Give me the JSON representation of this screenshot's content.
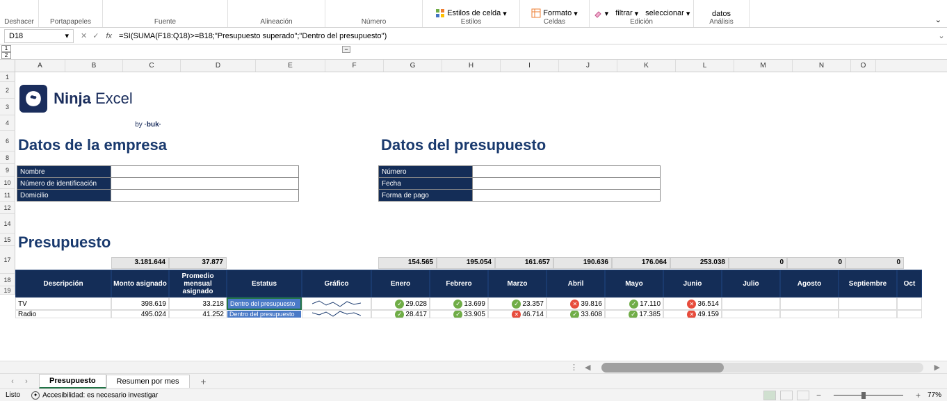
{
  "ribbon": {
    "groups": {
      "undo": "Deshacer",
      "clipboard": "Portapapeles",
      "font": "Fuente",
      "alignment": "Alineación",
      "number": "Número",
      "styles": "Estilos",
      "cells": "Celdas",
      "editing": "Edición",
      "analysis": "Análisis"
    },
    "styles_items": {
      "cell_styles": "Estilos de celda"
    },
    "cells_items": {
      "format": "Formato"
    },
    "editing_items": {
      "filter": "filtrar",
      "select": "seleccionar"
    },
    "analysis_items": {
      "data": "datos"
    }
  },
  "formula_bar": {
    "cell_ref": "D18",
    "formula": "=SI(SUMA(F18:Q18)>=B18;\"Presupuesto superado\";\"Dentro del presupuesto\")"
  },
  "outline": {
    "level1": "1",
    "level2": "2"
  },
  "columns": [
    "A",
    "B",
    "C",
    "D",
    "E",
    "F",
    "G",
    "H",
    "I",
    "J",
    "K",
    "L",
    "M",
    "N",
    "O"
  ],
  "rows": [
    "1",
    "2",
    "3",
    "4",
    "6",
    "8",
    "9",
    "10",
    "11",
    "12",
    "14",
    "15",
    "17",
    "18",
    "19"
  ],
  "logo": {
    "brand_bold": "Ninja",
    "brand_light": "Excel",
    "sub_prefix": "by",
    "sub": "·buk·"
  },
  "sections": {
    "company": "Datos de la empresa",
    "budget_info": "Datos del presupuesto",
    "budget": "Presupuesto"
  },
  "company_fields": {
    "name": "Nombre",
    "id_number": "Número de identificación",
    "address": "Domicilio"
  },
  "budget_fields": {
    "number": "Número",
    "date": "Fecha",
    "payment": "Forma de pago"
  },
  "totals": {
    "b": "3.181.644",
    "c": "37.877",
    "f": "154.565",
    "g": "195.054",
    "h": "161.657",
    "i": "190.636",
    "j": "176.064",
    "k": "253.038",
    "l": "0",
    "m": "0",
    "n": "0"
  },
  "table_headers": {
    "desc": "Descripción",
    "amount": "Monto asignado",
    "avg": "Promedio mensual asignado",
    "status": "Estatus",
    "chart": "Gráfico",
    "jan": "Enero",
    "feb": "Febrero",
    "mar": "Marzo",
    "apr": "Abril",
    "may": "Mayo",
    "jun": "Junio",
    "jul": "Julio",
    "aug": "Agosto",
    "sep": "Septiembre",
    "oct": "Oct"
  },
  "table_rows": [
    {
      "desc": "TV",
      "amount": "398.619",
      "avg": "33.218",
      "status": "Dentro del presupuesto",
      "months": [
        {
          "icon": "check",
          "val": "29.028"
        },
        {
          "icon": "check",
          "val": "13.699"
        },
        {
          "icon": "check",
          "val": "23.357"
        },
        {
          "icon": "x",
          "val": "39.816"
        },
        {
          "icon": "check",
          "val": "17.110"
        },
        {
          "icon": "x",
          "val": "36.514"
        }
      ]
    },
    {
      "desc": "Radio",
      "amount": "495.024",
      "avg": "41.252",
      "status": "Dentro del presupuesto",
      "months": [
        {
          "icon": "check",
          "val": "28.417"
        },
        {
          "icon": "check",
          "val": "33.905"
        },
        {
          "icon": "x",
          "val": "46.714"
        },
        {
          "icon": "check",
          "val": "33.608"
        },
        {
          "icon": "check",
          "val": "17.385"
        },
        {
          "icon": "x",
          "val": "49.159"
        }
      ]
    }
  ],
  "sheet_tabs": {
    "active": "Presupuesto",
    "other": "Resumen por mes"
  },
  "status_bar": {
    "ready": "Listo",
    "accessibility": "Accesibilidad: es necesario investigar",
    "zoom": "77%"
  }
}
